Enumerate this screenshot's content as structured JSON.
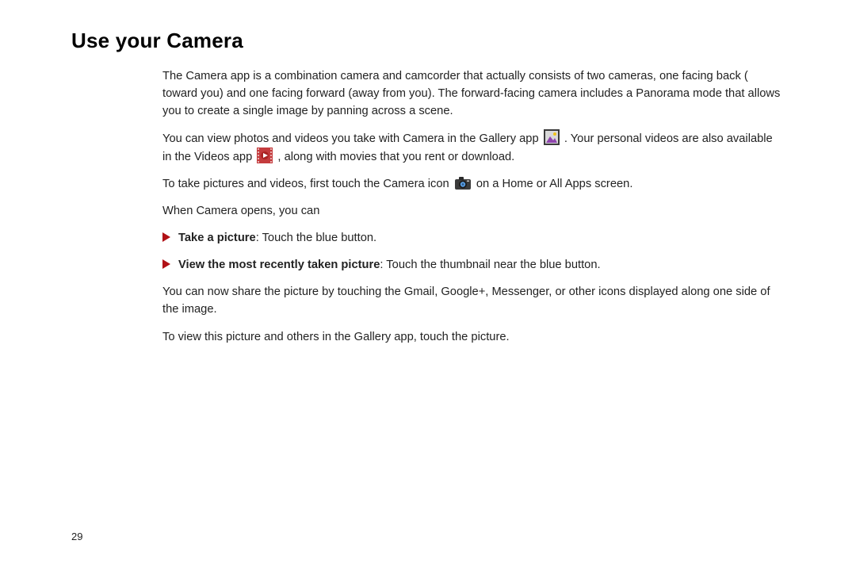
{
  "title": "Use your Camera",
  "p1": "The Camera app is a combination camera and camcorder that actually consists of two cameras, one facing back ( toward you) and one facing forward (away from you). The forward-facing camera includes a Panorama mode that allows you to create a single image by panning across a scene.",
  "p2a": "You can view photos and videos you take with Camera in the Gallery app ",
  "p2b": ". Your personal videos are also available in the Videos app ",
  "p2c": ", along with movies that you rent or download.",
  "p3a": "To take pictures and videos, first touch the Camera icon ",
  "p3b": " on a Home or All Apps screen.",
  "p4": "When Camera opens, you can",
  "bullets": {
    "b1_bold": "Take a picture",
    "b1_rest": ": Touch the blue button.",
    "b2_bold": "View the most recently taken picture",
    "b2_rest": ": Touch the thumbnail near the blue button."
  },
  "p5": "You can now share the picture by touching the Gmail, Google+, Messenger, or other icons displayed along one side of the image.",
  "p6": "To view this picture and others in the Gallery app, touch the picture.",
  "page_number": "29"
}
